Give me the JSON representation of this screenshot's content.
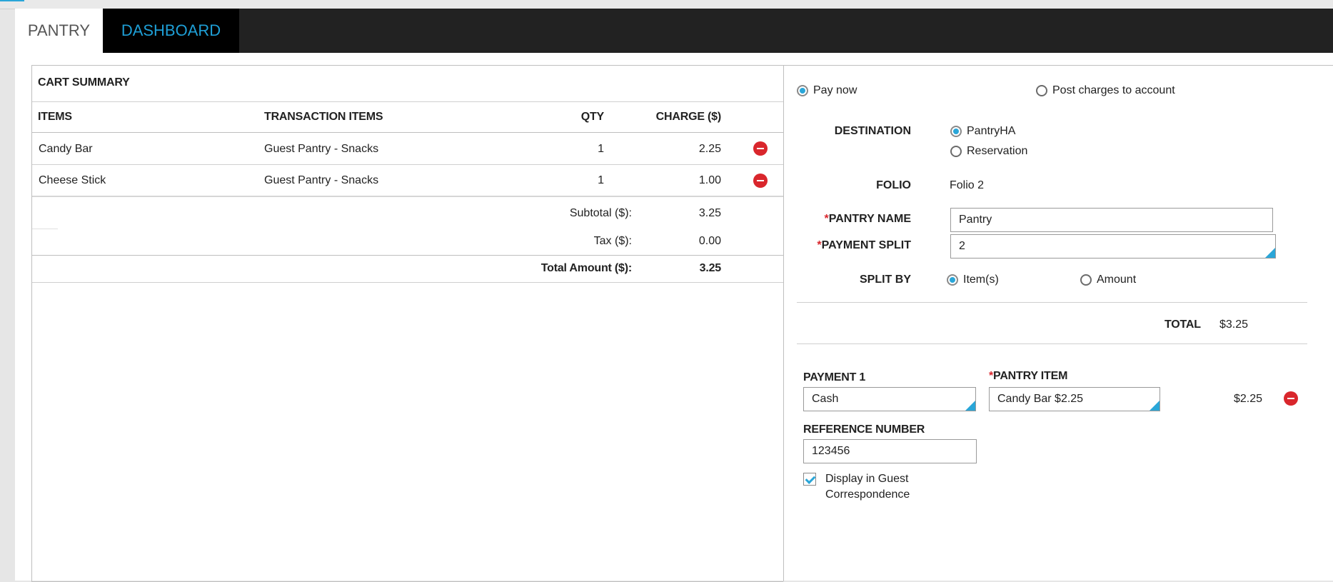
{
  "tabs": {
    "pantry": "PANTRY",
    "dashboard": "DASHBOARD"
  },
  "cart": {
    "title": "CART SUMMARY",
    "headers": {
      "items": "ITEMS",
      "transaction_items": "TRANSACTION ITEMS",
      "qty": "QTY",
      "charge": "CHARGE ($)"
    },
    "rows": [
      {
        "item": "Candy Bar",
        "transaction": "Guest Pantry - Snacks",
        "qty": "1",
        "charge": "2.25"
      },
      {
        "item": "Cheese Stick",
        "transaction": "Guest Pantry - Snacks",
        "qty": "1",
        "charge": "1.00"
      }
    ],
    "subtotal_label": "Subtotal ($):",
    "subtotal": "3.25",
    "tax_label": "Tax ($):",
    "tax": "0.00",
    "total_label": "Total Amount ($):",
    "total": "3.25"
  },
  "payment": {
    "pay_now": "Pay now",
    "post_charges": "Post charges to account",
    "selected_mode": "Pay now",
    "destination_label": "DESTINATION",
    "destination_options": [
      "PantryHA",
      "Reservation"
    ],
    "destination_selected": "PantryHA",
    "folio_label": "FOLIO",
    "folio_value": "Folio 2",
    "req_mark": "*",
    "pantry_name_label": "PANTRY NAME",
    "pantry_name_value": "Pantry",
    "payment_split_label": "PAYMENT SPLIT",
    "payment_split_value": "2",
    "split_by_label": "SPLIT BY",
    "split_by_options": [
      "Item(s)",
      "Amount"
    ],
    "split_by_selected": "Item(s)",
    "total_label": "TOTAL",
    "total_value": "$3.25"
  },
  "payment1": {
    "label": "PAYMENT 1",
    "method": "Cash",
    "pantry_item_label": "PANTRY ITEM",
    "pantry_item_value": "Candy Bar $2.25",
    "amount": "$2.25",
    "reference_label": "REFERENCE NUMBER",
    "reference_value": "123456",
    "display_checkbox_line1": "Display in Guest",
    "display_checkbox_line2": "Correspondence",
    "display_checked": true
  },
  "colors": {
    "accent": "#2aa6d8",
    "danger": "#d9262c",
    "tabbar": "#222222"
  }
}
